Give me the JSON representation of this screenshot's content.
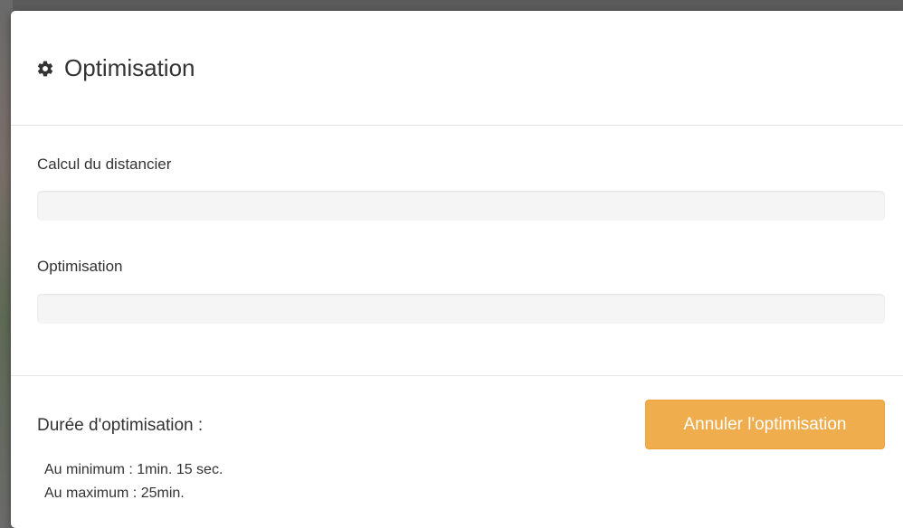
{
  "modal": {
    "title": "Optimisation",
    "title_icon": "gear-icon",
    "progress_items": [
      {
        "label": "Calcul du distancier",
        "progress": 0
      },
      {
        "label": "Optimisation",
        "progress": 0
      }
    ],
    "duration": {
      "title": "Durée d'optimisation :",
      "minimum": "Au minimum : 1min. 15 sec.",
      "maximum": "Au maximum : 25min."
    },
    "cancel_label": "Annuler l'optimisation",
    "colors": {
      "cancel_button": "#f0ad4e",
      "progress_track": "#f5f5f5"
    }
  }
}
